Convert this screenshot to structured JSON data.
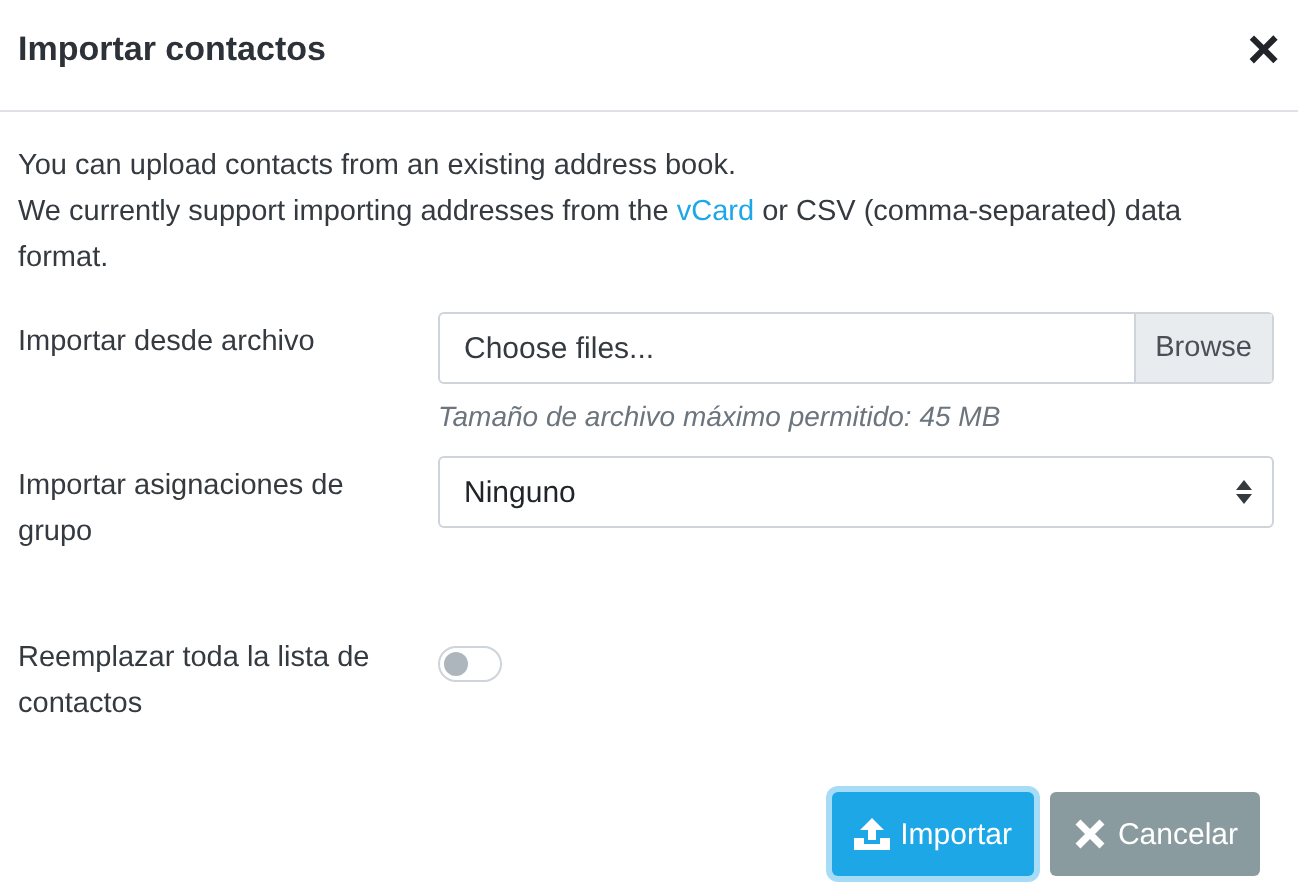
{
  "dialog": {
    "title": "Importar contactos",
    "close": "×"
  },
  "intro": {
    "line1": "You can upload contacts from an existing address book.",
    "line2_before": "We currently support importing addresses from the ",
    "link": "vCard",
    "line2_after": " or CSV (comma-separated) data format."
  },
  "fields": [
    {
      "kind": "file",
      "label": "Importar desde archivo",
      "placeholder": "Choose files...",
      "button": "Browse",
      "help": "Tamaño de archivo máximo permitido: 45 MB"
    },
    {
      "kind": "select",
      "label": "Importar asignaciones de grupo",
      "value": "Ninguno"
    },
    {
      "kind": "toggle",
      "label": "Reemplazar toda la lista de contactos",
      "on": false
    }
  ],
  "buttons": [
    {
      "kind": "primary",
      "label": "Importar"
    },
    {
      "kind": "cancel",
      "label": "Cancelar"
    }
  ]
}
